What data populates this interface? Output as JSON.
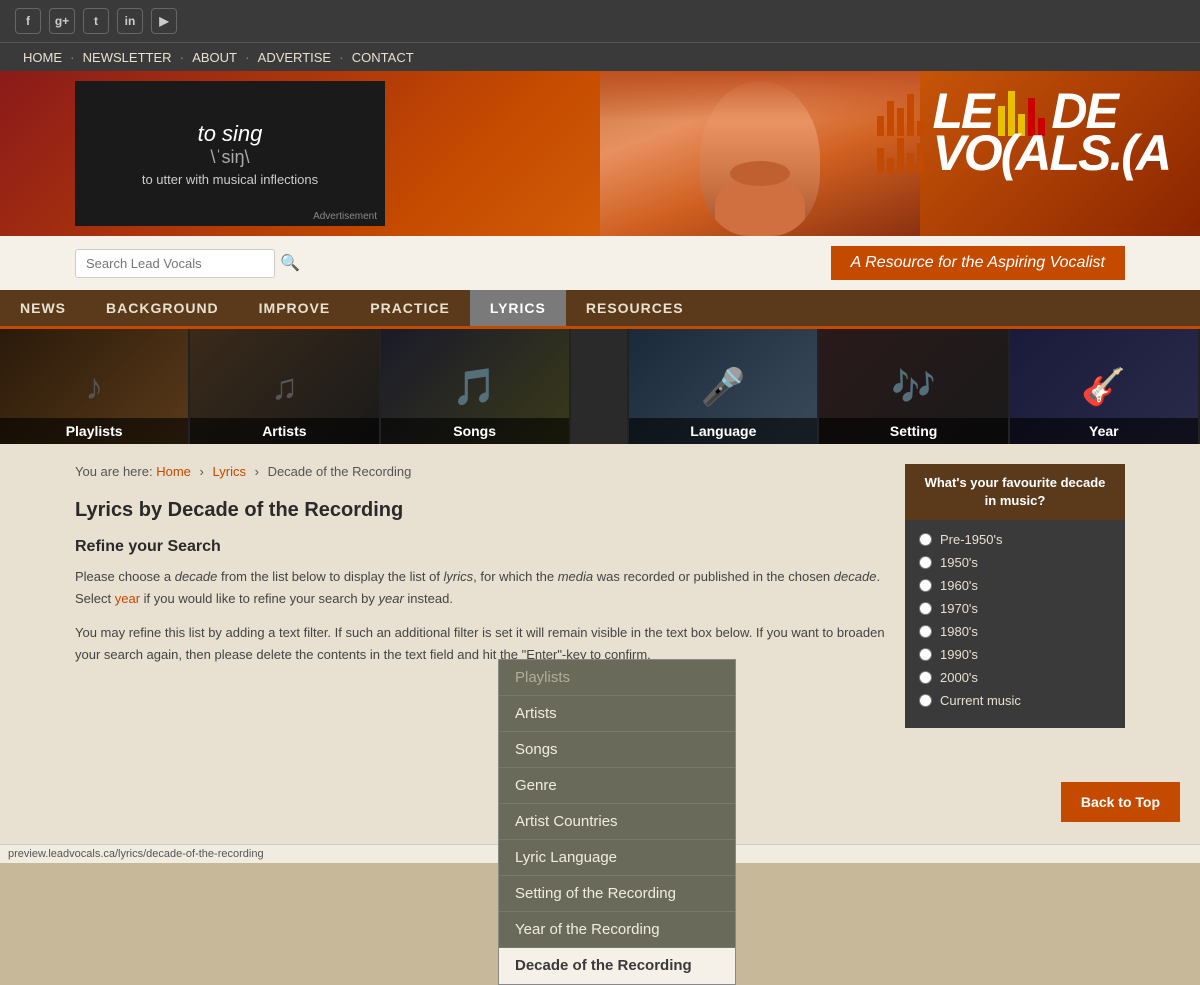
{
  "site": {
    "url": "preview.leadvocals.ca/lyrics/decade-of-the-recording",
    "tagline": "A Resource for the Aspiring Vocalist"
  },
  "social": {
    "icons": [
      "f",
      "g+",
      "t",
      "in",
      "yt"
    ]
  },
  "topnav": {
    "items": [
      "HOME",
      "NEWSLETTER",
      "ABOUT",
      "ADVERTISE",
      "CONTACT"
    ]
  },
  "search": {
    "placeholder": "Search Lead Vocals",
    "button_label": "🔍"
  },
  "mainnav": {
    "items": [
      "NEWS",
      "BACKGROUND",
      "IMPROVE",
      "PRACTICE",
      "LYRICS",
      "RESOURCES"
    ],
    "active": "LYRICS"
  },
  "categories": [
    {
      "label": "Playlists",
      "bg": "playlists"
    },
    {
      "label": "Artists",
      "bg": "artists"
    },
    {
      "label": "Songs",
      "bg": "songs"
    },
    {
      "label": "Language",
      "bg": "language"
    },
    {
      "label": "Setting",
      "bg": "setting"
    },
    {
      "label": "Year",
      "bg": "year"
    }
  ],
  "dropdown": {
    "items": [
      {
        "label": "Playlists",
        "dimmed": true
      },
      {
        "label": "Artists",
        "dimmed": false
      },
      {
        "label": "Songs",
        "dimmed": false
      },
      {
        "label": "Genre",
        "dimmed": false
      },
      {
        "label": "Artist Countries",
        "dimmed": false
      },
      {
        "label": "Lyric Language",
        "dimmed": false
      },
      {
        "label": "Setting of the Recording",
        "dimmed": false
      },
      {
        "label": "Year of the Recording",
        "dimmed": false
      },
      {
        "label": "Decade of the Recording",
        "active": true
      }
    ]
  },
  "breadcrumb": {
    "home": "Home",
    "parent": "Lyrics",
    "current": "Decade of the Recording"
  },
  "page": {
    "title": "Lyrics by Decade of the Recording",
    "refine_title": "Refine your Search",
    "intro1": "Please choose a decade from the list below to display the list of lyrics, for which the media was recorded or published in the chosen decade. Select year if you would like to refine your search by year instead.",
    "intro2": "You may refine this list by adding a text filter. If such an additional filter is set it will remain visible in the text box below. If you want to broaden your search again, then please delete the contents in the text field and hit the \"Enter\"-key to confirm."
  },
  "sidebar": {
    "title": "What's your favourite decade in music?",
    "options": [
      "Pre-1950's",
      "1950's",
      "1960's",
      "1970's",
      "1980's",
      "1990's",
      "2000's",
      "Current music"
    ]
  },
  "back_to_top": "Back to Top",
  "banner": {
    "ad_main": "to sing",
    "ad_phonetic": "\\ˈsiŋ\\",
    "ad_def": "to utter with musical inflections",
    "ad_label": "Advertisement"
  }
}
